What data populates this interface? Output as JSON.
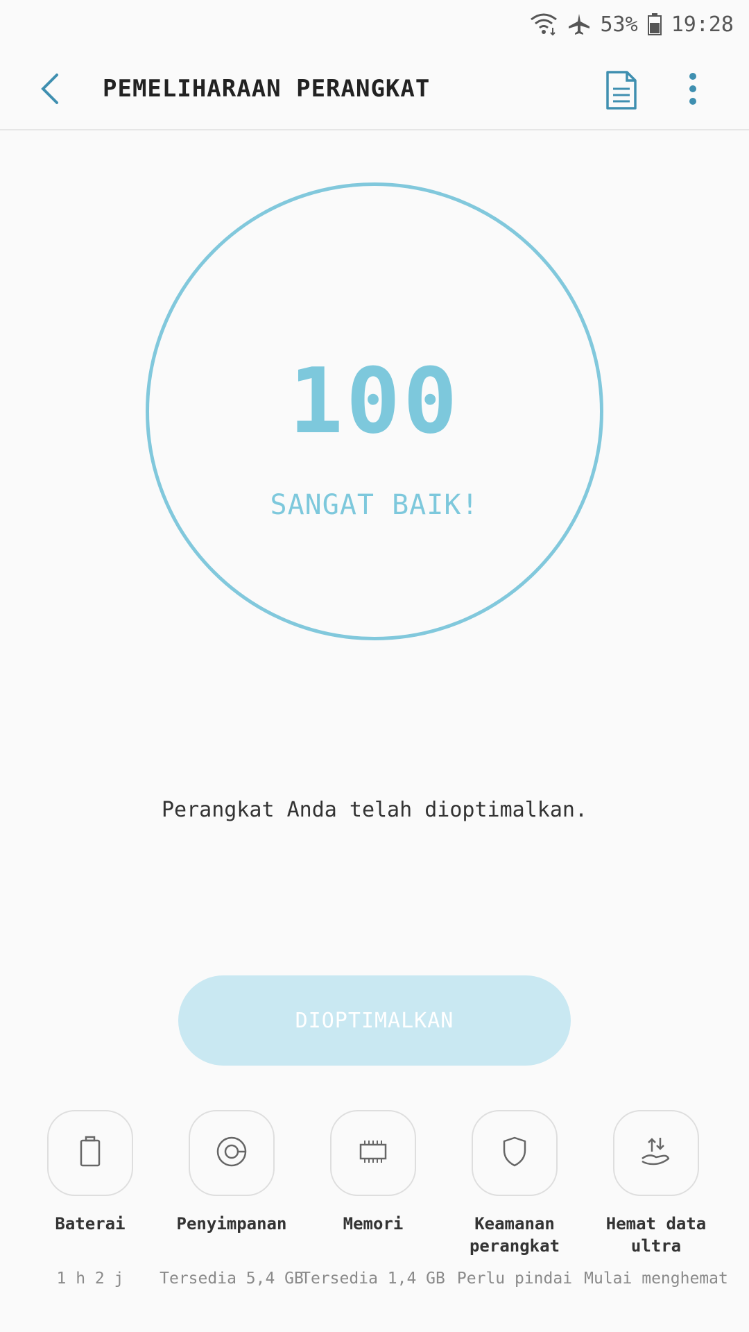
{
  "status_bar": {
    "battery_percent": "53%",
    "time": "19:28",
    "icons": [
      "wifi-icon",
      "airplane-icon",
      "battery-icon"
    ]
  },
  "app_bar": {
    "title": "PEMELIHARAAN PERANGKAT",
    "icons": [
      "back-arrow-icon",
      "document-icon",
      "more-vert-icon"
    ]
  },
  "score": {
    "value": "100",
    "label": "SANGAT BAIK!"
  },
  "message": "Perangkat Anda telah dioptimalkan.",
  "optimize_button": "DIOPTIMALKAN",
  "tools": [
    {
      "icon": "battery-icon",
      "label": "Baterai",
      "status": "1 h 2 j"
    },
    {
      "icon": "storage-icon",
      "label": "Penyimpanan",
      "status": "Tersedia 5,4 GB"
    },
    {
      "icon": "memory-chip-icon",
      "label": "Memori",
      "status": "Tersedia 1,4 GB"
    },
    {
      "icon": "shield-icon",
      "label": "Keamanan perangkat",
      "status": "Perlu pindai"
    },
    {
      "icon": "data-saver-icon",
      "label": "Hemat data ultra",
      "status": "Mulai menghemat"
    }
  ],
  "colors": {
    "accent": "#3f8fb0",
    "score": "#7dc8dc",
    "button_bg": "#c9e8f2"
  }
}
